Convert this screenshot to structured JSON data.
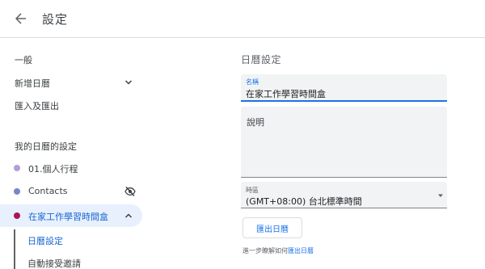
{
  "header": {
    "title": "設定",
    "back_icon": "arrow-left-icon"
  },
  "sidebar": {
    "general": "一般",
    "add_calendar": "新增日曆",
    "import_export": "匯入及匯出",
    "my_calendars_label": "我的日曆的設定",
    "calendars": [
      {
        "label": "01.個人行程",
        "color": "#b39ddb"
      },
      {
        "label": "Contacts",
        "color": "#7986cb"
      },
      {
        "label": "在家工作學習時間盒",
        "color": "#ad1457"
      }
    ],
    "sub_items": [
      "日曆設定",
      "自動接受邀請"
    ]
  },
  "main": {
    "section_title": "日曆設定",
    "name_label": "名稱",
    "name_value": "在家工作學習時間盒",
    "description_placeholder": "說明",
    "timezone_label": "時區",
    "timezone_value": "(GMT+08:00) 台北標準時間",
    "export_button": "匯出日曆",
    "learn_text": "進一步瞭解如何",
    "learn_link": "匯出日曆"
  },
  "colors": {
    "accent": "#1a73e8",
    "active_bg": "#e8f0fe"
  }
}
